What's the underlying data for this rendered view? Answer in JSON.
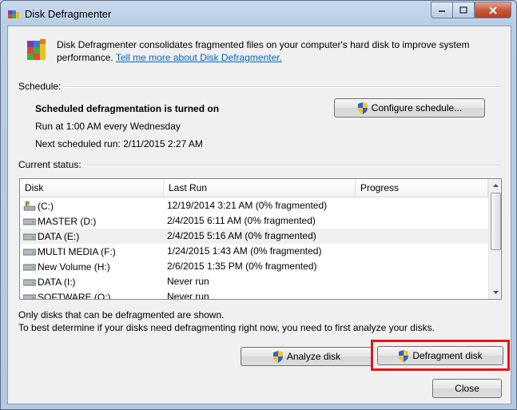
{
  "window": {
    "title": "Disk Defragmenter"
  },
  "intro": {
    "text": "Disk Defragmenter consolidates fragmented files on your computer's hard disk to improve system performance.",
    "link": "Tell me more about Disk Defragmenter."
  },
  "schedule": {
    "label": "Schedule:",
    "status": "Scheduled defragmentation is turned on",
    "run_at": "Run at 1:00 AM every Wednesday",
    "next_run": "Next scheduled run: 2/11/2015 2:27 AM",
    "configure_button": "Configure schedule..."
  },
  "current_status": {
    "label": "Current status:",
    "columns": [
      "Disk",
      "Last Run",
      "Progress"
    ],
    "rows": [
      {
        "disk": "(C:)",
        "last_run": "12/19/2014 3:21 AM (0% fragmented)",
        "icon": "system-drive-icon"
      },
      {
        "disk": "MASTER (D:)",
        "last_run": "2/4/2015 6:11 AM (0% fragmented)",
        "icon": "drive-icon"
      },
      {
        "disk": "DATA (E:)",
        "last_run": "2/4/2015 5:16 AM (0% fragmented)",
        "icon": "drive-icon",
        "selected": true
      },
      {
        "disk": "MULTI MEDIA (F:)",
        "last_run": "1/24/2015 1:43 AM (0% fragmented)",
        "icon": "drive-icon"
      },
      {
        "disk": "New Volume (H:)",
        "last_run": "2/6/2015 1:35 PM (0% fragmented)",
        "icon": "drive-icon"
      },
      {
        "disk": "DATA (I:)",
        "last_run": "Never run",
        "icon": "drive-icon"
      },
      {
        "disk": "SOFTWARE (O:)",
        "last_run": "Never run",
        "icon": "drive-icon"
      }
    ]
  },
  "notes": {
    "line1": "Only disks that can be defragmented are shown.",
    "line2": "To best determine if your disks need defragmenting right now, you need to first analyze your disks."
  },
  "buttons": {
    "analyze": "Analyze disk",
    "defragment": "Defragment disk",
    "close": "Close"
  },
  "colors": {
    "highlight_box": "#e3161b",
    "link": "#0066cc"
  }
}
